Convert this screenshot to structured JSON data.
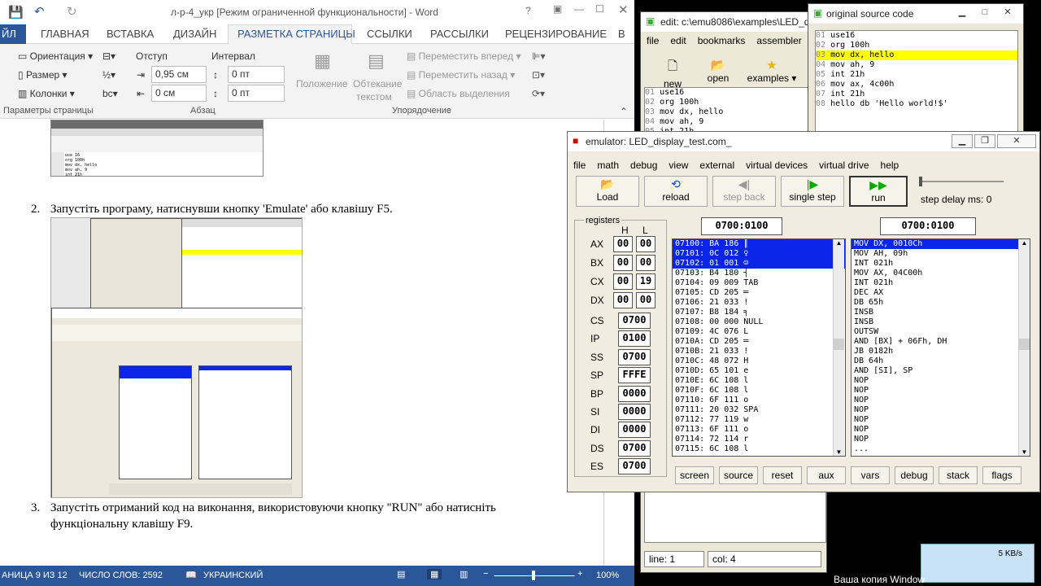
{
  "word": {
    "title": "л-р-4_укр [Режим ограниченной функциональности] - Word",
    "tabs": [
      "ЙЛ",
      "ГЛАВНАЯ",
      "ВСТАВКА",
      "ДИЗАЙН",
      "РАЗМЕТКА СТРАНИЦЫ",
      "ССЫЛКИ",
      "РАССЫЛКИ",
      "РЕЦЕНЗИРОВАНИЕ",
      "В"
    ],
    "ribbon": {
      "orientation": "Ориентация",
      "size": "Размер",
      "columns": "Колонки",
      "page_params": "Параметры страницы",
      "indent": "Отступ",
      "interval": "Интервал",
      "indent_left": "0,95 см",
      "indent_right": "0 см",
      "spacing_before": "0 пт",
      "spacing_after": "0 пт",
      "paragraph": "Абзац",
      "position": "Положение",
      "wrap1": "Обтекание",
      "wrap2": "текстом",
      "forward": "Переместить вперед",
      "backward": "Переместить назад",
      "selection": "Область выделения",
      "arrange": "Упорядочение"
    },
    "doc": {
      "item2_num": "2.",
      "item2": "Запустіть програму, натиснувши кнопку 'Emulate' або клавішу F5.",
      "item3_num": "3.",
      "item3_l1": "Запустіть отриманий код на виконання, використовуючи кнопку \"RUN\" або натисніть",
      "item3_l2": "функціональну клавішу F9."
    },
    "status": {
      "page": "АНИЦА 9 ИЗ 12",
      "words": "ЧИСЛО СЛОВ: 2592",
      "lang": "УКРАИНСКИЙ",
      "zoom": "100%"
    }
  },
  "editor": {
    "title": "edit: c:\\emu8086\\examples\\LED_d",
    "menu": [
      "file",
      "edit",
      "bookmarks",
      "assembler"
    ],
    "buttons": [
      "new",
      "open",
      "examples"
    ],
    "lines": [
      {
        "n": "01",
        "t": "use16"
      },
      {
        "n": "02",
        "t": "org 100h"
      },
      {
        "n": "03",
        "t": "mov dx, hello"
      },
      {
        "n": "04",
        "t": "mov ah, 9"
      },
      {
        "n": "05",
        "t": "int 21h"
      }
    ],
    "status_line": "line: 1",
    "status_col": "col: 4"
  },
  "orig": {
    "title": "original source code",
    "lines": [
      {
        "n": "01",
        "t": "use16"
      },
      {
        "n": "02",
        "t": "org 100h"
      },
      {
        "n": "03",
        "t": "mov dx, hello"
      },
      {
        "n": "04",
        "t": "mov ah, 9"
      },
      {
        "n": "05",
        "t": "int 21h"
      },
      {
        "n": "06",
        "t": "mov ax, 4c00h"
      },
      {
        "n": "07",
        "t": "int 21h"
      },
      {
        "n": "08",
        "t": "hello db 'Hello world!$'"
      }
    ]
  },
  "emu": {
    "title": "emulator: LED_display_test.com_",
    "menu": [
      "file",
      "math",
      "debug",
      "view",
      "external",
      "virtual devices",
      "virtual drive",
      "help"
    ],
    "buttons": {
      "load": "Load",
      "reload": "reload",
      "step_back": "step back",
      "single_step": "single step",
      "run": "run",
      "delay": "step delay ms: 0"
    },
    "registers_label": "registers",
    "h": "H",
    "l": "L",
    "addr1": "0700:0100",
    "addr2": "0700:0100",
    "regs8": [
      {
        "n": "AX",
        "h": "00",
        "l": "00"
      },
      {
        "n": "BX",
        "h": "00",
        "l": "00"
      },
      {
        "n": "CX",
        "h": "00",
        "l": "19"
      },
      {
        "n": "DX",
        "h": "00",
        "l": "00"
      }
    ],
    "regs16": [
      {
        "n": "CS",
        "v": "0700"
      },
      {
        "n": "IP",
        "v": "0100"
      },
      {
        "n": "SS",
        "v": "0700"
      },
      {
        "n": "SP",
        "v": "FFFE"
      },
      {
        "n": "BP",
        "v": "0000"
      },
      {
        "n": "SI",
        "v": "0000"
      },
      {
        "n": "DI",
        "v": "0000"
      },
      {
        "n": "DS",
        "v": "0700"
      },
      {
        "n": "ES",
        "v": "0700"
      }
    ],
    "mem": [
      "07100: BA 186 ║",
      "07101: 0C 012 ♀",
      "07102: 01 001 ☺",
      "07103: B4 180 ┤",
      "07104: 09 009 TAB",
      "07105: CD 205 ═",
      "07106: 21 033 !",
      "07107: B8 184 ╕",
      "07108: 00 000 NULL",
      "07109: 4C 076 L",
      "0710A: CD 205 ═",
      "0710B: 21 033 !",
      "0710C: 48 072 H",
      "0710D: 65 101 e",
      "0710E: 6C 108 l",
      "0710F: 6C 108 l",
      "07110: 6F 111 o",
      "07111: 20 032 SPA",
      "07112: 77 119 w",
      "07113: 6F 111 o",
      "07114: 72 114 r",
      "07115: 6C 108 l"
    ],
    "dis": [
      "MOV DX, 0010Ch",
      "MOV AH, 09h",
      "INT 021h",
      "MOV AX, 04C00h",
      "INT 021h",
      "DEC AX",
      "DB 65h",
      "INSB",
      "INSB",
      "OUTSW",
      "AND [BX] + 06Fh, DH",
      "JB 0182h",
      "DB 64h",
      "AND [SI], SP",
      "NOP",
      "NOP",
      "NOP",
      "NOP",
      "NOP",
      "NOP",
      "NOP",
      "..."
    ],
    "bottom": [
      "screen",
      "source",
      "reset",
      "aux",
      "vars",
      "debug",
      "stack",
      "flags"
    ]
  },
  "tray": {
    "speed": "5 KB/s",
    "activation": "Ваша копия Window"
  }
}
